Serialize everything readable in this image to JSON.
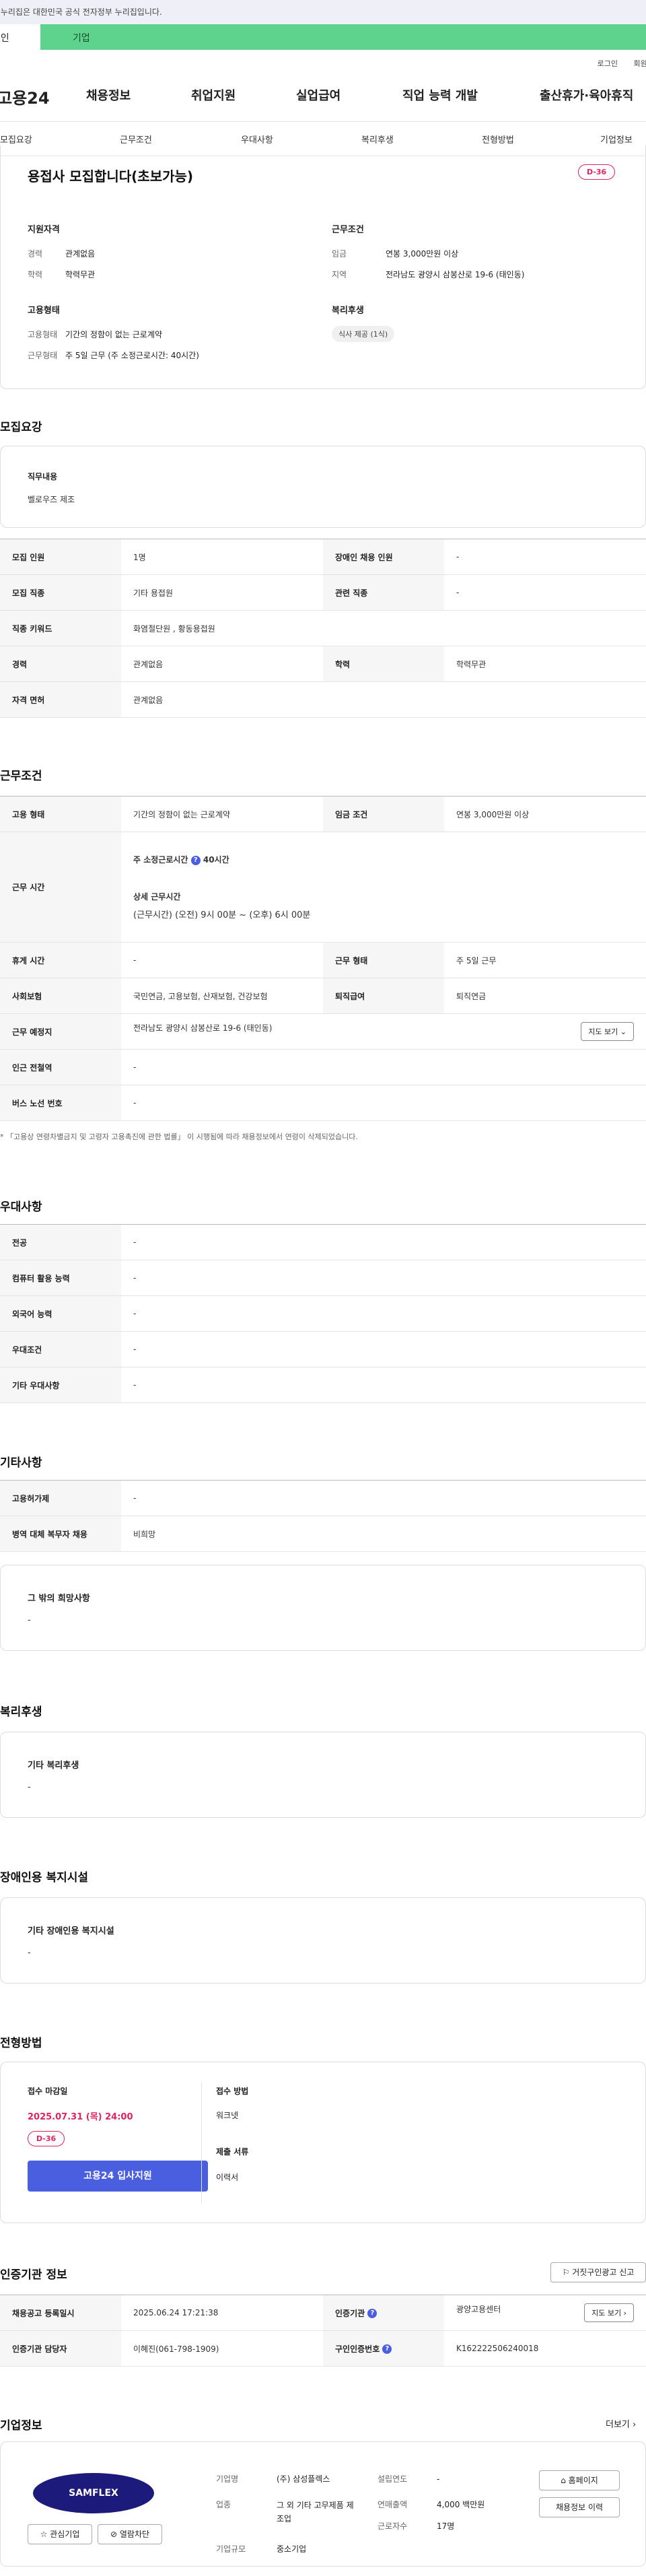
{
  "gov_bar": {
    "text": "이 누리집은 대한민국 공식 전자정부 누리집입니다."
  },
  "user_tabs": {
    "personal": "개인",
    "corporate": "기업"
  },
  "util": {
    "login": "로그인",
    "join": "회원가입"
  },
  "gnb": {
    "logo": "고용24",
    "items": [
      "채용정보",
      "취업지원",
      "실업급여",
      "직업 능력 개발",
      "출산휴가·육아휴직"
    ]
  },
  "tabs": [
    "모집요강",
    "근무조건",
    "우대사항",
    "복리후생",
    "전형방법",
    "기업정보"
  ],
  "summary": {
    "title": "용접사 모집합니다(초보가능)",
    "dday": "D-36",
    "qual_h": "지원자격",
    "career_l": "경력",
    "career_v": "관계없음",
    "edu_l": "학력",
    "edu_v": "학력무관",
    "emp_h": "고용형태",
    "emp_l": "고용형태",
    "emp_v": "기간의 정함이 없는 근로계약",
    "hours_l": "근무형태",
    "hours_v": "주 5일 근무 (주 소정근로시간: 40시간)",
    "cond_h": "근무조건",
    "wage_l": "임금",
    "wage_v": "연봉 3,000만원 이상",
    "region_l": "지역",
    "region_v": "전라남도 광양시 삼봉산로 19-6 (태인동)",
    "welfare_h": "복리후생",
    "welfare_chip": "식사 제공 (1식)"
  },
  "recruit": {
    "title": "모집요강",
    "duty_h": "직무내용",
    "duty_v": "벨로우즈 제조",
    "rows": [
      [
        "모집 인원",
        "1명",
        "장애인 채용 인원",
        "-"
      ],
      [
        "모집 직종",
        "기타 용접원",
        "관련 직종",
        "-"
      ],
      [
        "직종 키워드",
        "화염절단원 , 황동용접원",
        "",
        ""
      ],
      [
        "경력",
        "관계없음",
        "학력",
        "학력무관"
      ],
      [
        "자격 면허",
        "관계없음",
        "",
        ""
      ]
    ]
  },
  "work": {
    "title": "근무조건",
    "type_l": "고용 형태",
    "type_v": "기간의 정함이 없는 근로계약",
    "wage_l": "임금 조건",
    "wage_v": "연봉 3,000만원 이상",
    "time_l": "근무 시간",
    "time_a": "주 소정근로시간",
    "time_b": "40시간",
    "time_c": "상세 근무시간",
    "time_d": "(근무시간) (오전) 9시 00분 ~ (오후) 6시 00분",
    "rest_l": "휴게 시간",
    "rest_v": "-",
    "form_l": "근무 형태",
    "form_v": "주 5일 근무",
    "ins_l": "사회보험",
    "ins_v": "국민연금, 고용보험, 산재보험, 건강보험",
    "ret_l": "퇴직급여",
    "ret_v": "퇴직연금",
    "place_l": "근무 예정지",
    "place_v": "전라남도 광양시 삼봉산로 19-6 (태인동)",
    "map_btn": "지도 보기",
    "sub_l": "인근 전철역",
    "sub_v": "-",
    "bus_l": "버스 노선 번호",
    "bus_v": "-",
    "note": "* 「고용상 연령차별금지 및 고령자 고용촉진에 관한 법률」 이 시행됨에 따라 채용정보에서 연령이 삭제되었습니다."
  },
  "pref": {
    "title": "우대사항",
    "rows": [
      [
        "전공",
        "-"
      ],
      [
        "컴퓨터 활용 능력",
        "-"
      ],
      [
        "외국어 능력",
        "-"
      ],
      [
        "우대조건",
        "-"
      ],
      [
        "기타 우대사항",
        "-"
      ]
    ]
  },
  "etc": {
    "title": "기타사항",
    "rows": [
      [
        "고용허가제",
        "-"
      ],
      [
        "병역 대체 복무자 채용",
        "비희망"
      ]
    ],
    "wish_h": "그 밖의 희망사항",
    "wish_v": "-"
  },
  "welfare": {
    "title": "복리후생",
    "h": "기타 복리후생",
    "v": "-"
  },
  "disabled": {
    "title": "장애인용 복지시설",
    "h": "기타 장애인용 복지시설",
    "v": "-"
  },
  "selection": {
    "title": "전형방법",
    "deadline_h": "접수 마감일",
    "deadline_v": "2025.07.31 (목) 24:00",
    "dday": "D-36",
    "apply": "고용24 입사지원",
    "method_h": "접수 방법",
    "method_v": "워크넷",
    "docs_h": "제출 서류",
    "docs_v": "이력서"
  },
  "agency": {
    "title": "인증기관 정보",
    "report": "거짓구인광고 신고",
    "reg_l": "채용공고 등록일시",
    "reg_v": "2025.06.24 17:21:38",
    "org_l": "인증기관",
    "org_v": "광양고용센터",
    "map_btn": "지도 보기",
    "mgr_l": "인증기관 담당자",
    "mgr_v": "이혜진(061-798-1909)",
    "no_l": "구인인증번호",
    "no_v": "K162222506240018"
  },
  "company": {
    "title": "기업정보",
    "more": "더보기",
    "logo_text": "SAMFLEX",
    "fav": "관심기업",
    "block": "열람차단",
    "name_l": "기업명",
    "name_v": "(주) 삼성플렉스",
    "ind_l": "업종",
    "ind_v": "그 외 기타 고무제품 제조업",
    "size_l": "기업규모",
    "size_v": "중소기업",
    "est_l": "설립연도",
    "est_v": "-",
    "sales_l": "연매출액",
    "sales_v": "4,000 백만원",
    "emp_l": "근로자수",
    "emp_v": "17명",
    "home_btn": "홈페이지",
    "history_btn": "채용정보 이력"
  }
}
